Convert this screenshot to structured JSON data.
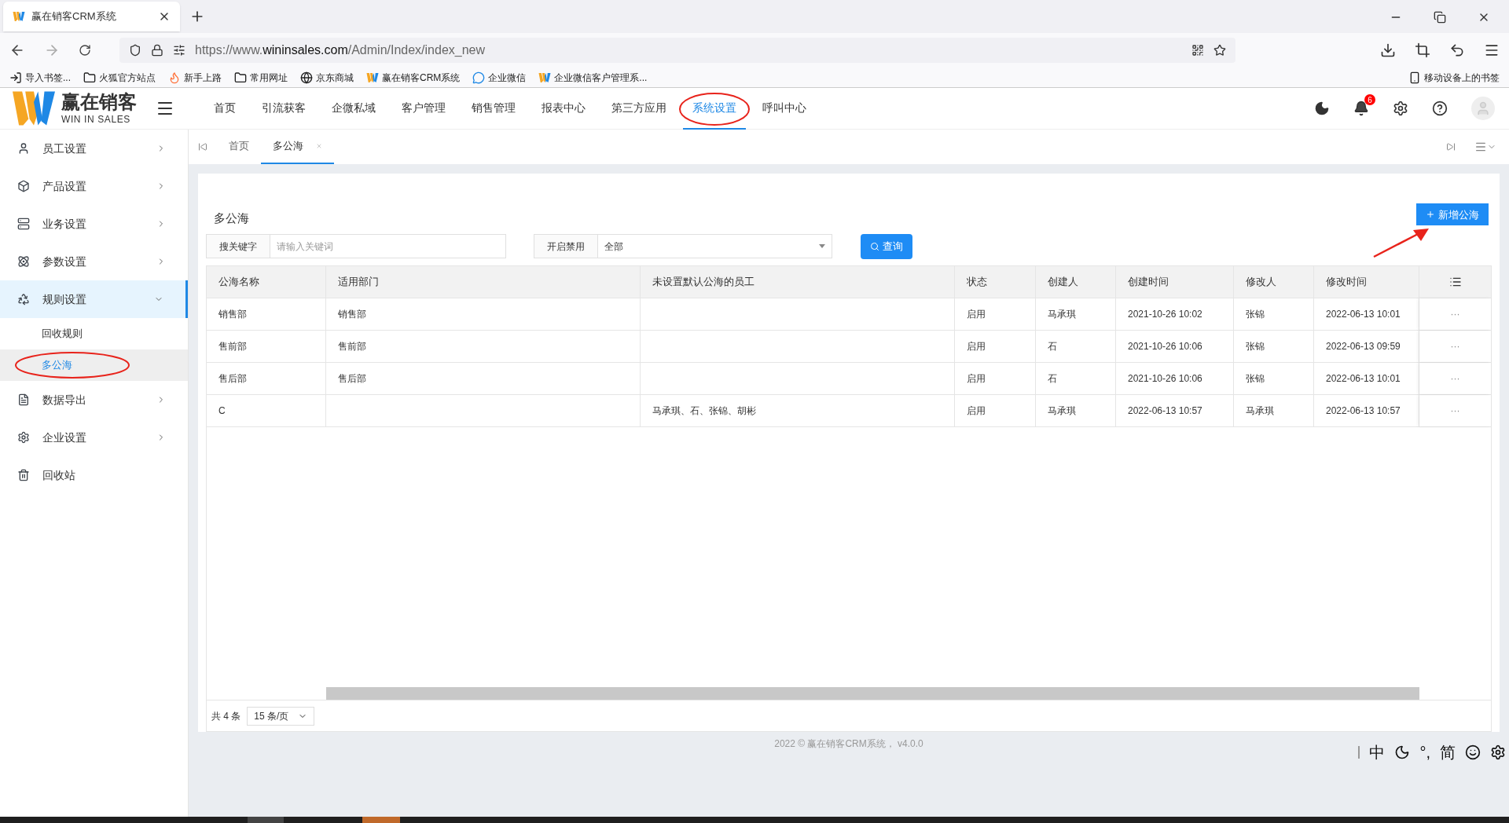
{
  "browser": {
    "tab_title": "赢在销客CRM系统",
    "url_prefix": "https://www.",
    "url_host": "wininsales.com",
    "url_path": "/Admin/Index/index_new",
    "bookmarks": [
      {
        "label": "导入书签...",
        "kind": "import"
      },
      {
        "label": "火狐官方站点",
        "kind": "folder"
      },
      {
        "label": "新手上路",
        "kind": "firefox"
      },
      {
        "label": "常用网址",
        "kind": "folder"
      },
      {
        "label": "京东商城",
        "kind": "globe"
      },
      {
        "label": "赢在销客CRM系统",
        "kind": "logo"
      },
      {
        "label": "企业微信",
        "kind": "chat"
      },
      {
        "label": "企业微信客户管理系...",
        "kind": "logo"
      }
    ],
    "mobile_bookmarks": "移动设备上的书签"
  },
  "app": {
    "logo_name": "赢在销客",
    "logo_sub": "WIN IN SALES",
    "nav": [
      {
        "label": "首页",
        "selected": false
      },
      {
        "label": "引流获客",
        "selected": false
      },
      {
        "label": "企微私域",
        "selected": false
      },
      {
        "label": "客户管理",
        "selected": false
      },
      {
        "label": "销售管理",
        "selected": false
      },
      {
        "label": "报表中心",
        "selected": false
      },
      {
        "label": "第三方应用",
        "selected": false
      },
      {
        "label": "系统设置",
        "selected": true
      },
      {
        "label": "呼叫中心",
        "selected": false
      }
    ],
    "notification_count": "6"
  },
  "sidebar": {
    "items": [
      {
        "label": "员工设置",
        "kind": "user",
        "expanded": false,
        "selected": false
      },
      {
        "label": "产品设置",
        "kind": "box",
        "expanded": false,
        "selected": false
      },
      {
        "label": "业务设置",
        "kind": "server",
        "expanded": false,
        "selected": false
      },
      {
        "label": "参数设置",
        "kind": "atom",
        "expanded": false,
        "selected": false
      },
      {
        "label": "规则设置",
        "kind": "recycle",
        "expanded": true,
        "selected": true,
        "children": [
          {
            "label": "回收规则",
            "selected": false
          },
          {
            "label": "多公海",
            "selected": true
          }
        ]
      },
      {
        "label": "数据导出",
        "kind": "file",
        "expanded": false,
        "selected": false
      },
      {
        "label": "企业设置",
        "kind": "gear",
        "expanded": false,
        "selected": false
      },
      {
        "label": "回收站",
        "kind": "trash",
        "selected": false
      }
    ]
  },
  "tabs": [
    {
      "label": "首页",
      "selected": false,
      "closable": false
    },
    {
      "label": "多公海",
      "selected": true,
      "closable": true
    }
  ],
  "page": {
    "title": "多公海",
    "add_button": "新增公海",
    "search": {
      "label": "搜关键字",
      "placeholder": "请输入关键词"
    },
    "filter": {
      "label": "开启禁用",
      "value": "全部"
    },
    "query_button": "查询"
  },
  "table": {
    "columns": [
      "公海名称",
      "适用部门",
      "未设置默认公海的员工",
      "状态",
      "创建人",
      "创建时间",
      "修改人",
      "修改时间"
    ],
    "rows": [
      {
        "cells": [
          "销售部",
          "销售部",
          "",
          "启用",
          "马承琪",
          "2021-10-26 10:02",
          "张锦",
          "2022-06-13 10:01"
        ],
        "action": "···"
      },
      {
        "cells": [
          "售前部",
          "售前部",
          "",
          "启用",
          "石",
          "2021-10-26 10:06",
          "张锦",
          "2022-06-13 09:59"
        ],
        "action": "···"
      },
      {
        "cells": [
          "售后部",
          "售后部",
          "",
          "启用",
          "石",
          "2021-10-26 10:06",
          "张锦",
          "2022-06-13 10:01"
        ],
        "action": "···"
      },
      {
        "cells": [
          "C",
          "",
          "马承琪、石、张锦、胡彬",
          "启用",
          "马承琪",
          "2022-06-13 10:57",
          "马承琪",
          "2022-06-13 10:57"
        ],
        "action": "···"
      }
    ],
    "total": "共 4 条",
    "page_size": "15 条/页"
  },
  "footer": "2022 © 赢在销客CRM系统， v4.0.0",
  "ime": {
    "mode": "中",
    "punct": "°,",
    "script": "简"
  }
}
